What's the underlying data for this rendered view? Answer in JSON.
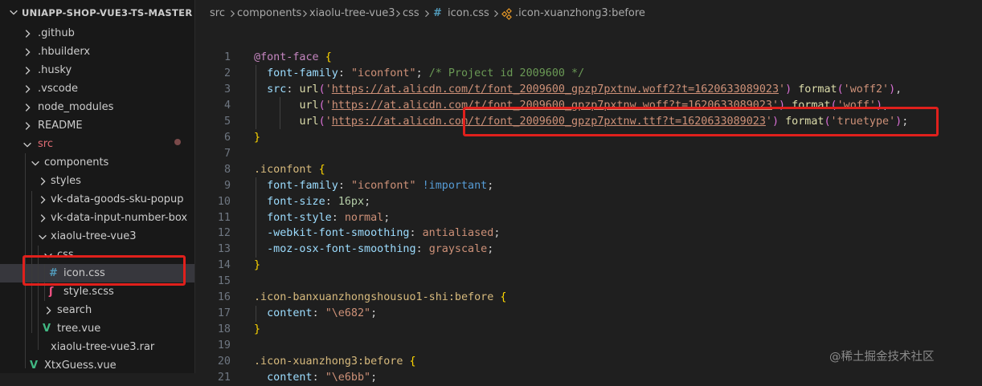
{
  "explorer": {
    "project_title": "UNIAPP-SHOP-VUE3-TS-MASTER",
    "items": [
      {
        "label": ".github",
        "kind": "folder",
        "expanded": false,
        "depth": 0
      },
      {
        "label": ".hbuilderx",
        "kind": "folder",
        "expanded": false,
        "depth": 0
      },
      {
        "label": ".husky",
        "kind": "folder",
        "expanded": false,
        "depth": 0
      },
      {
        "label": ".vscode",
        "kind": "folder",
        "expanded": false,
        "depth": 0
      },
      {
        "label": "node_modules",
        "kind": "folder",
        "expanded": false,
        "depth": 0
      },
      {
        "label": "README",
        "kind": "folder",
        "expanded": false,
        "depth": 0
      },
      {
        "label": "src",
        "kind": "folder",
        "expanded": true,
        "depth": 0
      },
      {
        "label": "components",
        "kind": "folder",
        "expanded": true,
        "depth": 1
      },
      {
        "label": "styles",
        "kind": "folder",
        "expanded": false,
        "depth": 2
      },
      {
        "label": "vk-data-goods-sku-popup",
        "kind": "folder",
        "expanded": false,
        "depth": 2
      },
      {
        "label": "vk-data-input-number-box",
        "kind": "folder",
        "expanded": false,
        "depth": 2
      },
      {
        "label": "xiaolu-tree-vue3",
        "kind": "folder",
        "expanded": true,
        "depth": 2
      },
      {
        "label": "css",
        "kind": "folder",
        "expanded": true,
        "depth": 3
      },
      {
        "label": "icon.css",
        "kind": "css-file",
        "depth": 4,
        "selected": true
      },
      {
        "label": "style.scss",
        "kind": "scss-file",
        "depth": 4
      },
      {
        "label": "search",
        "kind": "folder",
        "expanded": false,
        "depth": 3
      },
      {
        "label": "tree.vue",
        "kind": "vue-file",
        "depth": 3
      },
      {
        "label": "xiaolu-tree-vue3.rar",
        "kind": "archive-file",
        "depth": 2
      },
      {
        "label": "XtxGuess.vue",
        "kind": "vue-file",
        "depth": 1
      }
    ]
  },
  "breadcrumb": {
    "parts": [
      "src",
      "components",
      "xiaolu-tree-vue3",
      "css",
      "icon.css",
      ".icon-xuanzhong3:before"
    ]
  },
  "code_lines": [
    {
      "n": "1",
      "tokens": [
        [
          "at",
          "@font-face"
        ],
        [
          "pun",
          " "
        ],
        [
          "br1",
          "{"
        ]
      ]
    },
    {
      "n": "2",
      "tokens": [
        [
          "pun",
          "  "
        ],
        [
          "prop",
          "font-family"
        ],
        [
          "pun",
          ": "
        ],
        [
          "str",
          "\"iconfont\""
        ],
        [
          "pun",
          "; "
        ],
        [
          "com",
          "/* Project id 2009600 */"
        ]
      ]
    },
    {
      "n": "3",
      "tokens": [
        [
          "pun",
          "  "
        ],
        [
          "prop",
          "src"
        ],
        [
          "pun",
          ": "
        ],
        [
          "fn",
          "url"
        ],
        [
          "br2",
          "("
        ],
        [
          "str",
          "'"
        ],
        [
          "url",
          "https://at.alicdn.com/t/font_2009600_gpzp7pxtnw.woff2?t=1620633089023"
        ],
        [
          "str",
          "'"
        ],
        [
          "br2",
          ")"
        ],
        [
          "pun",
          " "
        ],
        [
          "fn",
          "format"
        ],
        [
          "br2",
          "("
        ],
        [
          "str",
          "'woff2'"
        ],
        [
          "br2",
          ")"
        ],
        [
          "pun",
          ","
        ]
      ]
    },
    {
      "n": "4",
      "tokens": [
        [
          "pun",
          "       "
        ],
        [
          "fn",
          "url"
        ],
        [
          "br2",
          "("
        ],
        [
          "str",
          "'"
        ],
        [
          "url",
          "https://at.alicdn.com/t/font_2009600_gpzp7pxtnw.woff?t=1620633089023"
        ],
        [
          "str",
          "'"
        ],
        [
          "br2",
          ")"
        ],
        [
          "pun",
          " "
        ],
        [
          "fn",
          "format"
        ],
        [
          "br2",
          "("
        ],
        [
          "str",
          "'woff'"
        ],
        [
          "br2",
          ")"
        ],
        [
          "pun",
          ","
        ]
      ]
    },
    {
      "n": "5",
      "tokens": [
        [
          "pun",
          "       "
        ],
        [
          "fn",
          "url"
        ],
        [
          "br2",
          "("
        ],
        [
          "str",
          "'"
        ],
        [
          "url",
          "https://at.alicdn.com/t/font_2009600_gpzp7pxtnw.ttf?t=1620633089023"
        ],
        [
          "str",
          "'"
        ],
        [
          "br2",
          ")"
        ],
        [
          "pun",
          " "
        ],
        [
          "fn",
          "format"
        ],
        [
          "br2",
          "("
        ],
        [
          "str",
          "'truetype'"
        ],
        [
          "br2",
          ")"
        ],
        [
          "pun",
          ";"
        ]
      ]
    },
    {
      "n": "6",
      "tokens": [
        [
          "br1",
          "}"
        ]
      ]
    },
    {
      "n": "7",
      "tokens": []
    },
    {
      "n": "8",
      "tokens": [
        [
          "sel",
          ".iconfont"
        ],
        [
          "pun",
          " "
        ],
        [
          "br1",
          "{"
        ]
      ]
    },
    {
      "n": "9",
      "tokens": [
        [
          "pun",
          "  "
        ],
        [
          "prop",
          "font-family"
        ],
        [
          "pun",
          ": "
        ],
        [
          "str",
          "\"iconfont\""
        ],
        [
          "pun",
          " "
        ],
        [
          "imp",
          "!important"
        ],
        [
          "pun",
          ";"
        ]
      ]
    },
    {
      "n": "10",
      "tokens": [
        [
          "pun",
          "  "
        ],
        [
          "prop",
          "font-size"
        ],
        [
          "pun",
          ": "
        ],
        [
          "num",
          "16px"
        ],
        [
          "pun",
          ";"
        ]
      ]
    },
    {
      "n": "11",
      "tokens": [
        [
          "pun",
          "  "
        ],
        [
          "prop",
          "font-style"
        ],
        [
          "pun",
          ": "
        ],
        [
          "str",
          "normal"
        ],
        [
          "pun",
          ";"
        ]
      ]
    },
    {
      "n": "12",
      "tokens": [
        [
          "pun",
          "  "
        ],
        [
          "prop",
          "-webkit-font-smoothing"
        ],
        [
          "pun",
          ": "
        ],
        [
          "str",
          "antialiased"
        ],
        [
          "pun",
          ";"
        ]
      ]
    },
    {
      "n": "13",
      "tokens": [
        [
          "pun",
          "  "
        ],
        [
          "prop",
          "-moz-osx-font-smoothing"
        ],
        [
          "pun",
          ": "
        ],
        [
          "str",
          "grayscale"
        ],
        [
          "pun",
          ";"
        ]
      ]
    },
    {
      "n": "14",
      "tokens": [
        [
          "br1",
          "}"
        ]
      ]
    },
    {
      "n": "15",
      "tokens": []
    },
    {
      "n": "16",
      "tokens": [
        [
          "sel",
          ".icon-banxuanzhongshousuo1-shi:before"
        ],
        [
          "pun",
          " "
        ],
        [
          "br1",
          "{"
        ]
      ]
    },
    {
      "n": "17",
      "tokens": [
        [
          "pun",
          "  "
        ],
        [
          "prop",
          "content"
        ],
        [
          "pun",
          ": "
        ],
        [
          "str",
          "\"\\e682\""
        ],
        [
          "pun",
          ";"
        ]
      ]
    },
    {
      "n": "18",
      "tokens": [
        [
          "br1",
          "}"
        ]
      ]
    },
    {
      "n": "19",
      "tokens": []
    },
    {
      "n": "20",
      "tokens": [
        [
          "sel",
          ".icon-xuanzhong3:before"
        ],
        [
          "pun",
          " "
        ],
        [
          "br1",
          "{"
        ]
      ]
    },
    {
      "n": "21",
      "tokens": [
        [
          "pun",
          "  "
        ],
        [
          "prop",
          "content"
        ],
        [
          "pun",
          ": "
        ],
        [
          "str",
          "\"\\e6bb\""
        ],
        [
          "pun",
          ";"
        ]
      ]
    }
  ],
  "watermark": "@稀土掘金技术社区",
  "colors": {
    "accent_red": "#e0201c",
    "css_icon": "#519aba",
    "vue_icon": "#41b883",
    "scss_icon": "#f55385",
    "src_folder_label": "#e06c75"
  }
}
